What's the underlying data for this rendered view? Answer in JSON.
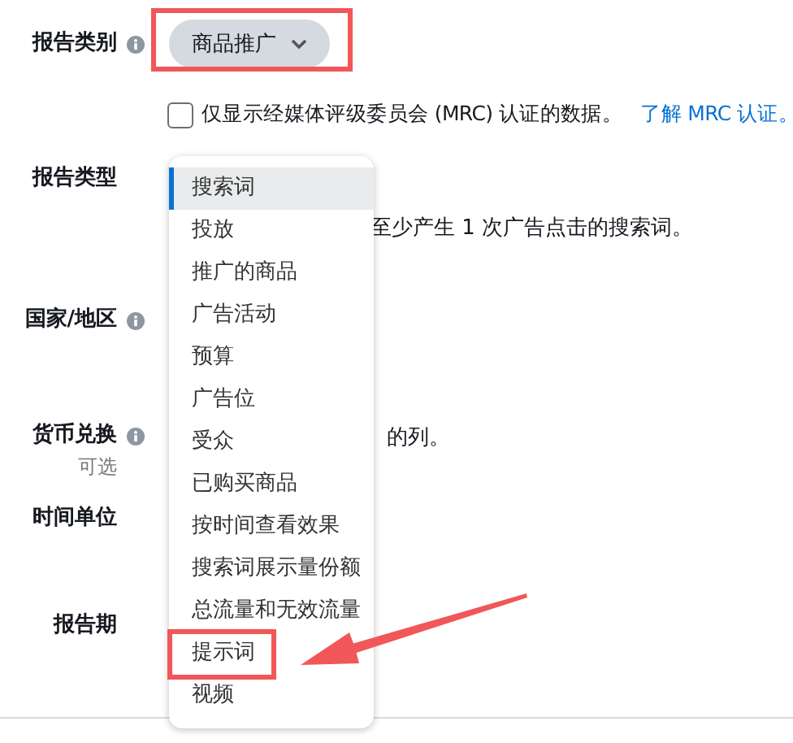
{
  "report_category": {
    "label": "报告类别",
    "info": true,
    "dropdown": {
      "value": "商品推广",
      "highlighted": true
    },
    "mrc": {
      "checked": false,
      "text": "仅显示经媒体评级委员会 (MRC) 认证的数据。",
      "link": "了解 MRC 认证。"
    }
  },
  "report_type": {
    "label": "报告类型",
    "info": false,
    "partial_text": "至少产生 1 次广告点击的搜索词。"
  },
  "country": {
    "label": "国家/地区",
    "info": true
  },
  "currency": {
    "label": "货币兑换",
    "info": true,
    "hint": "可选",
    "partial_text": "的列。"
  },
  "time_unit": {
    "label": "时间单位",
    "info": false
  },
  "report_period": {
    "label": "报告期",
    "info": false
  },
  "menu": {
    "items": [
      {
        "label": "搜索词",
        "selected": true,
        "highlighted": false
      },
      {
        "label": "投放",
        "selected": false,
        "highlighted": false
      },
      {
        "label": "推广的商品",
        "selected": false,
        "highlighted": false
      },
      {
        "label": "广告活动",
        "selected": false,
        "highlighted": false
      },
      {
        "label": "预算",
        "selected": false,
        "highlighted": false
      },
      {
        "label": "广告位",
        "selected": false,
        "highlighted": false
      },
      {
        "label": "受众",
        "selected": false,
        "highlighted": false
      },
      {
        "label": "已购买商品",
        "selected": false,
        "highlighted": false
      },
      {
        "label": "按时间查看效果",
        "selected": false,
        "highlighted": false
      },
      {
        "label": "搜索词展示量份额",
        "selected": false,
        "highlighted": false
      },
      {
        "label": "总流量和无效流量",
        "selected": false,
        "highlighted": false
      },
      {
        "label": "提示词",
        "selected": false,
        "highlighted": true
      },
      {
        "label": "视频",
        "selected": false,
        "highlighted": false
      }
    ]
  }
}
